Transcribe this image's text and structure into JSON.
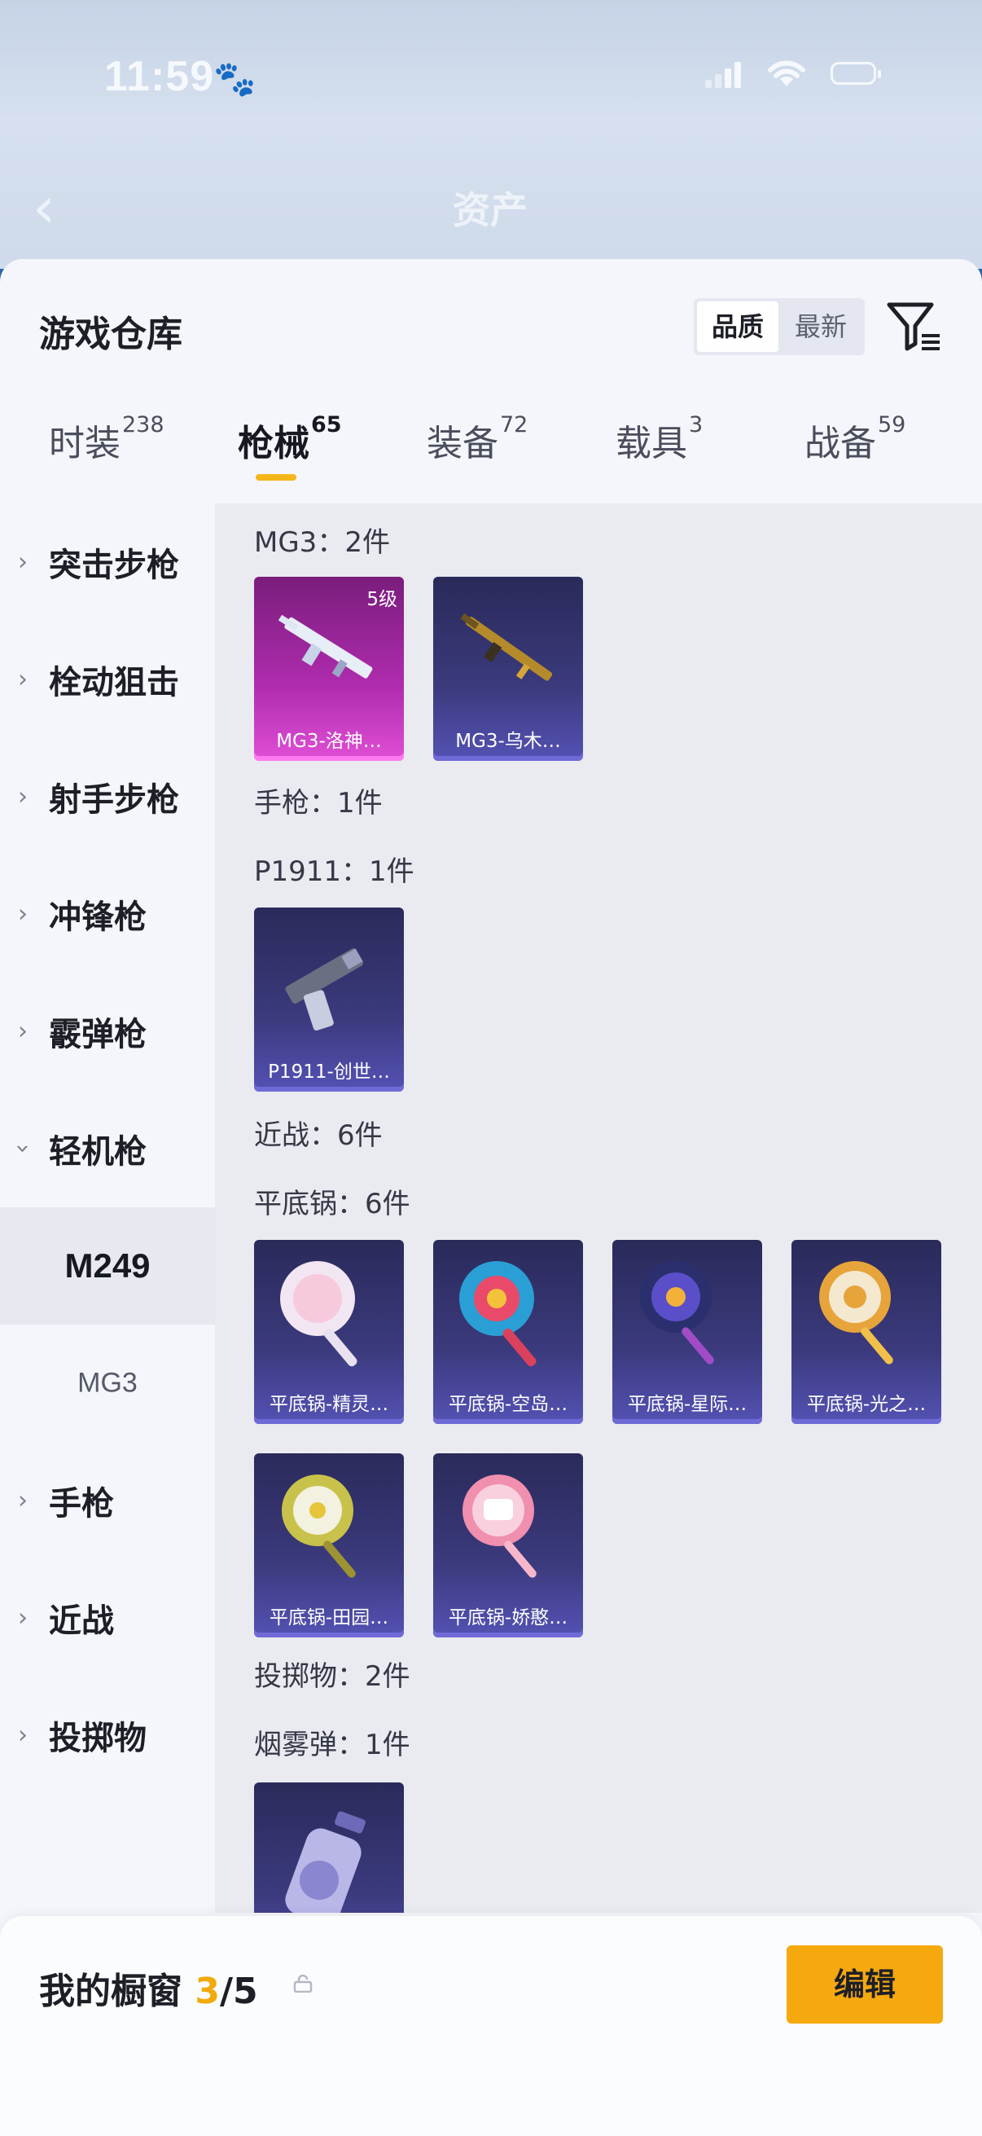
{
  "status_bar": {
    "time": "11:59"
  },
  "header": {
    "title": "资产"
  },
  "sheet": {
    "title": "游戏仓库",
    "sort_options": [
      "品质",
      "最新"
    ],
    "sort_active": "品质"
  },
  "tabs": [
    {
      "label": "时装",
      "count": "238"
    },
    {
      "label": "枪械",
      "count": "65"
    },
    {
      "label": "装备",
      "count": "72"
    },
    {
      "label": "载具",
      "count": "3"
    },
    {
      "label": "战备",
      "count": "59"
    }
  ],
  "sidebar": {
    "items": [
      {
        "label": "突击步枪"
      },
      {
        "label": "栓动狙击"
      },
      {
        "label": "射手步枪"
      },
      {
        "label": "冲锋枪"
      },
      {
        "label": "霰弹枪"
      },
      {
        "label": "轻机枪"
      }
    ],
    "sub_items": [
      {
        "label": "M249"
      },
      {
        "label": "MG3"
      }
    ],
    "items_after": [
      {
        "label": "手枪"
      },
      {
        "label": "近战"
      },
      {
        "label": "投掷物"
      }
    ]
  },
  "content": {
    "sections": [
      {
        "title": "MG3：2件"
      },
      {
        "title": "手枪：1件"
      },
      {
        "title": "P1911：1件"
      },
      {
        "title": "近战：6件"
      },
      {
        "title": "平底锅：6件"
      },
      {
        "title": "投掷物：2件"
      },
      {
        "title": "烟雾弹：1件"
      }
    ],
    "cards": [
      {
        "name": "MG3-洛神…",
        "level": "5级"
      },
      {
        "name": "MG3-乌木…"
      },
      {
        "name": "P1911-创世…"
      },
      {
        "name": "平底锅-精灵…"
      },
      {
        "name": "平底锅-空岛…"
      },
      {
        "name": "平底锅-星际…"
      },
      {
        "name": "平底锅-光之…"
      },
      {
        "name": "平底锅-田园…"
      },
      {
        "name": "平底锅-娇憨…"
      },
      {
        "name": ""
      }
    ]
  },
  "bottom": {
    "label": "我的橱窗",
    "current": "3",
    "separator_total": "/5",
    "edit_label": "编辑"
  },
  "colors": {
    "accent": "#f6a90f",
    "card_epic": "#3b3a7d",
    "card_legendary": "#b02caf"
  }
}
